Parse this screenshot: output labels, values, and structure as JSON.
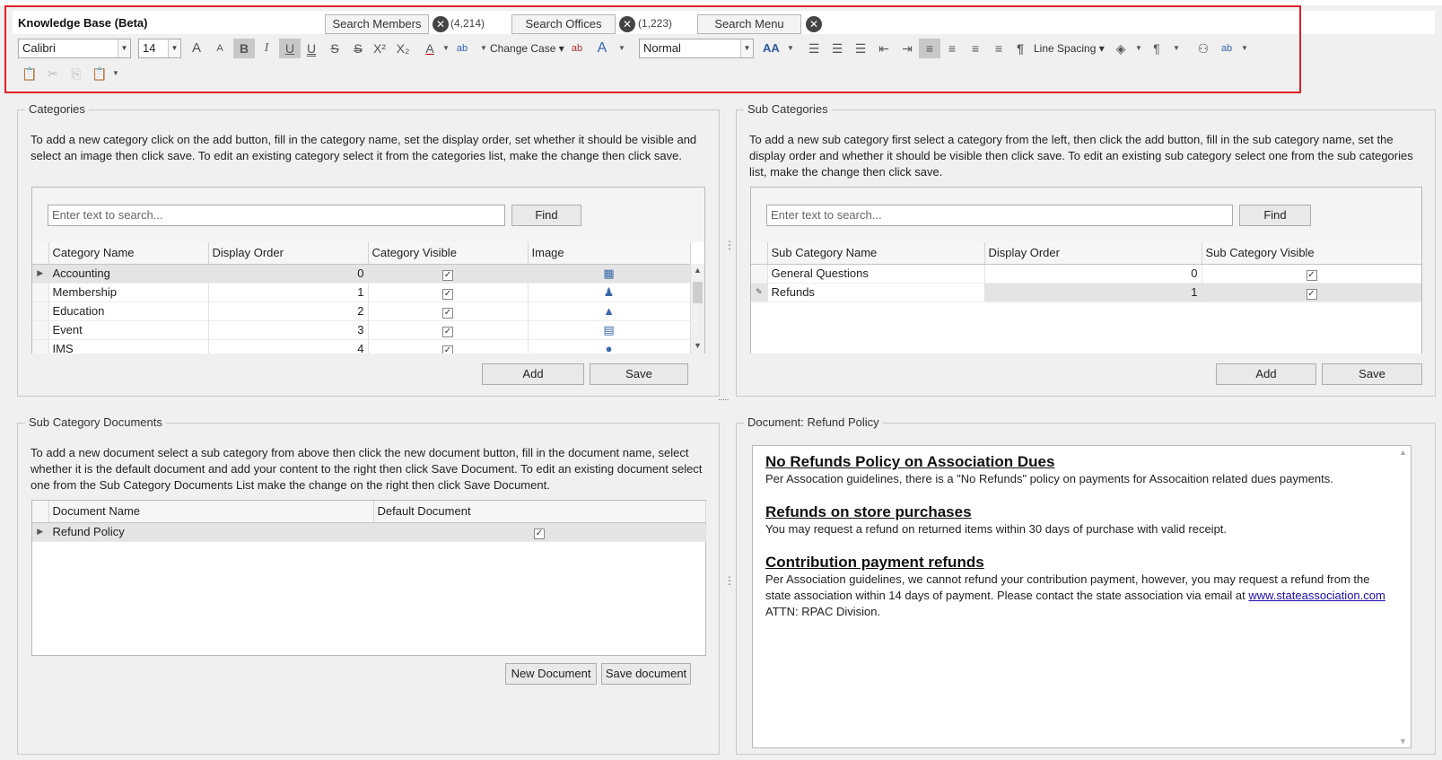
{
  "app": {
    "title": "Knowledge Base (Beta)",
    "search_members": "Search Members",
    "members_count": "(4,214)",
    "search_offices": "Search Offices",
    "offices_count": "(1,223)",
    "search_menu": "Search Menu",
    "clear_glyph": "✕"
  },
  "toolbar": {
    "font": "Calibri",
    "size": "14",
    "change_case": "Change Case",
    "style": "Normal",
    "line_spacing": "Line Spacing",
    "grow_font": "A",
    "shrink_font": "A",
    "bold": "B",
    "italic": "I",
    "underline": "U",
    "double_underline": "U",
    "strike": "S",
    "double_strike": "S",
    "superscript": "X²",
    "subscript": "X₂",
    "font_color": "A",
    "highlight": "ab",
    "text_effect": "A",
    "paragraph_mark": "¶"
  },
  "categories": {
    "title": "Categories",
    "description": "To add a new category click on the add button, fill in the category name, set the display order, set whether it should be visible and select an image then click save. To edit an existing category select it from the categories list, make the change then click save.",
    "search_placeholder": "Enter text to search...",
    "find_label": "Find",
    "columns": [
      "Category Name",
      "Display Order",
      "Category Visible",
      "Image"
    ],
    "rows": [
      {
        "name": "Accounting",
        "order": "0",
        "visible": "✓",
        "icon": "accounting-icon"
      },
      {
        "name": "Membership",
        "order": "1",
        "visible": "✓",
        "icon": "membership-icon"
      },
      {
        "name": "Education",
        "order": "2",
        "visible": "✓",
        "icon": "education-icon"
      },
      {
        "name": "Event",
        "order": "3",
        "visible": "✓",
        "icon": "event-icon"
      },
      {
        "name": "IMS",
        "order": "4",
        "visible": "✓",
        "icon": "ims-icon"
      }
    ],
    "add_label": "Add",
    "save_label": "Save"
  },
  "subcategories": {
    "title": "Sub Categories",
    "description": "To add a new sub category first select a category from the left, then click the add button, fill in the sub category name, set the display order and whether it should be visible then click save. To edit an existing sub category select one from the sub categories list, make the change then click save.",
    "search_placeholder": "Enter text to search...",
    "find_label": "Find",
    "columns": [
      "Sub Category Name",
      "Display Order",
      "Sub Category Visible"
    ],
    "rows": [
      {
        "name": "General Questions",
        "order": "0",
        "visible": "✓"
      },
      {
        "name": "Refunds",
        "order": "1",
        "visible": "✓"
      }
    ],
    "add_label": "Add",
    "save_label": "Save"
  },
  "documents": {
    "title": "Sub Category Documents",
    "description": "To add a new document select a sub category from above then click the new document button, fill in the document name, select whether it is the default document and add your content to the right then click Save Document. To edit an existing document select one from the Sub Category Documents List make the change on the right then click Save Document.",
    "columns": [
      "Document Name",
      "Default Document"
    ],
    "rows": [
      {
        "name": "Refund Policy",
        "default": "✓"
      }
    ],
    "new_label": "New Document",
    "save_label": "Save document"
  },
  "document": {
    "title": "Document: Refund Policy",
    "h1": "No Refunds Policy on Association Dues",
    "p1": "Per Assocation guidelines, there is a \"No Refunds\" policy on payments for Assocaition related dues payments.",
    "h2": "Refunds on store purchases",
    "p2": "You may request a refund on returned items within 30 days of purchase with valid receipt.",
    "h3": "Contribution payment refunds",
    "p3": "Per Association guidelines, we cannot refund your contribution payment, however, you may request a refund from the state association within 14 days of payment. Please contact the state association via email at",
    "link": "www.stateassociation.com",
    "p3_tail": " ATTN: RPAC Division."
  }
}
